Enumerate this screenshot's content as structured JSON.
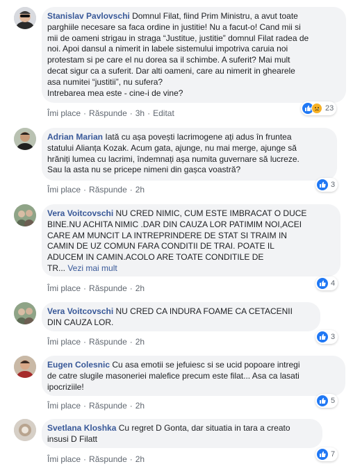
{
  "comments": [
    {
      "author": "Stanislav Pavlovschi",
      "text": "Domnul Filat, fiind Prim Ministru, a avut toate\nparghiile necesare sa faca ordine in justitie! Nu a facut-o! Cand mii si\nmii de oameni strigau in straga “Justitue, justitie” domnul Filat radea de\nnoi. Apoi dansul a nimerit in labele sistemului impotriva caruia noi\nprotestam si pe care el nu dorea sa il schimbe. A suferit? Mai mult\ndecat sigur ca a suferit. Dar alti oameni, care au nimerit in ghearele\nasa numitei “justitii”, nu sufera?\nIntrebarea mea este - cine-i de vine?",
      "like": "Îmi place",
      "reply": "Răspunde",
      "time": "3h",
      "edited": "Editat",
      "reaction_count": "23",
      "reaction_types": [
        "like",
        "sad"
      ]
    },
    {
      "author": "Adrian Marian",
      "text": "Iată cu așa povești lacrimogene ați adus în fruntea\nstatului Alianța Kozak. Acum gata, ajunge, nu mai merge, ajunge să\nhrăniți lumea cu lacrimi, îndemnați așa numita guvernare să lucreze.\nSau la asta nu se pricepe nimeni din gașca voastră?",
      "like": "Îmi place",
      "reply": "Răspunde",
      "time": "2h",
      "reaction_count": "3",
      "reaction_types": [
        "like"
      ]
    },
    {
      "author": "Vera Voitcovschi",
      "text": "NU CRED NIMIC, CUM ESTE IMBRACAT O DUCE\nBINE.NU ACHITA NIMIC .DAR DIN CAUZA LOR PATIMIM NOI,ACEI\nCARE AM MUNCIT LA INTREPRINDERE DE STAT SI TRAIM IN\nCAMIN DE UZ COMUN FARA CONDITII DE TRAI. POATE IL\nADUCEM IN CAMIN.ACOLO ARE TOATE CONDITILE DE\nTR...",
      "see_more": "Vezi mai mult",
      "like": "Îmi place",
      "reply": "Răspunde",
      "time": "2h",
      "reaction_count": "4",
      "reaction_types": [
        "like"
      ]
    },
    {
      "author": "Vera Voitcovschi",
      "text": "NU CRED CA INDURA FOAME CA CETACENII\nDIN CAUZA LOR.",
      "like": "Îmi place",
      "reply": "Răspunde",
      "time": "2h",
      "reaction_count": "3",
      "reaction_types": [
        "like"
      ]
    },
    {
      "author": "Eugen Colesnic",
      "text": "Cu asa emotii se jefuiesc si se ucid popoare intregi\nde catre slugile masoneriei malefice precum este filat... Asa ca lasati\nipocriziile!",
      "like": "Îmi place",
      "reply": "Răspunde",
      "time": "2h",
      "reaction_count": "5",
      "reaction_types": [
        "like"
      ]
    },
    {
      "author": "Svetlana Kloshka",
      "text": "Cu regret D Gonta, dar situatia in tara a creato\ninsusi D Filatt",
      "like": "Îmi place",
      "reply": "Răspunde",
      "time": "2h",
      "reaction_count": "7",
      "reaction_types": [
        "like"
      ]
    }
  ],
  "colors": {
    "author": "#385898",
    "bubble": "#f2f3f5",
    "meta": "#606770",
    "like_reaction": "#2078f4",
    "sad_reaction": "#f7b125"
  }
}
